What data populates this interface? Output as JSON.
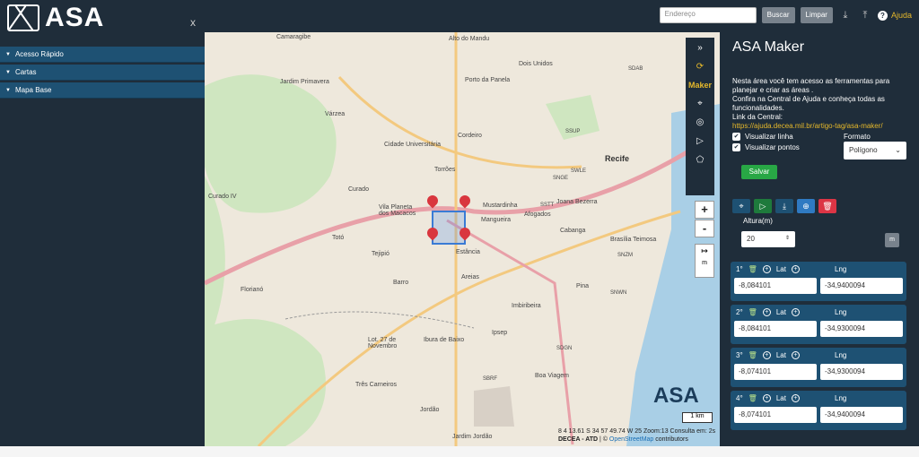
{
  "app": {
    "logo_text": "ASA",
    "close_label": "x"
  },
  "topbar": {
    "address_placeholder": "Endereço",
    "search_label": "Buscar",
    "clear_label": "Limpar",
    "help_label": "Ajuda"
  },
  "sidebar": {
    "items": [
      {
        "label": "Acesso Rápido"
      },
      {
        "label": "Cartas"
      },
      {
        "label": "Mapa Base"
      }
    ]
  },
  "map": {
    "labels": [
      "Camaragibe",
      "Alto do Mandu",
      "Dois Unidos",
      "Jardim Primavera",
      "Porto da Panela",
      "Várzea",
      "Cidade Universitária",
      "Cordeiro",
      "Torrões",
      "Recife",
      "Curado IV",
      "Mustardinha",
      "Curado",
      "Vila Planeta dos Macacos",
      "Mangueira",
      "Afogados",
      "Joana Bezerra",
      "Cabanga",
      "Totó",
      "Tejipió",
      "Estância",
      "Areias",
      "Brasília Teimosa",
      "Barro",
      "Pina",
      "Florianó",
      "Ibura de Baixo",
      "Ipsep",
      "Imbiribeira",
      "Boa Viagem",
      "Lot. 27 de Novembro",
      "Três Carneiros",
      "Jordão",
      "Jardim Jordão"
    ],
    "airports": [
      "SDAB",
      "SSUP",
      "SNGE",
      "SWLE",
      "SSTT",
      "SNZM",
      "SNWN",
      "SDGN",
      "SBRF"
    ],
    "zoom_in": "+",
    "zoom_out": "-",
    "measure_label": "m",
    "coord_readout": "8 4 13.61 S 34 57 49.74 W 25 Zoom:13 Consulta em: 2s",
    "attribution_owner": "DECEA - ATD",
    "attribution_link": "OpenStreetMap",
    "attribution_suffix": "contributors",
    "scale_label": "1 km",
    "brand": "ASA"
  },
  "tools": {
    "maker_label": "Maker"
  },
  "panel": {
    "title": "ASA Maker",
    "desc1": "Nesta área você tem acesso as ferramentas para planejar e criar as áreas .",
    "desc2": "Confira na Central de Ajuda e conheça todas as funcionalidades.",
    "desc3": "Link da Central:",
    "link": "https://ajuda.decea.mil.br/artigo-tag/asa-maker/",
    "show_line": "Visualizar linha",
    "show_points": "Visualizar pontos",
    "format_label": "Formato",
    "format_value": "Polígono",
    "save_label": "Salvar",
    "height_label": "Altura(m)",
    "height_value": "20",
    "height_unit": "m",
    "lat_label": "Lat",
    "lng_label": "Lng",
    "points": [
      {
        "index": "1°",
        "lat": "-8,084101",
        "lng": "-34,9400094"
      },
      {
        "index": "2°",
        "lat": "-8,084101",
        "lng": "-34,9300094"
      },
      {
        "index": "3°",
        "lat": "-8,074101",
        "lng": "-34,9300094"
      },
      {
        "index": "4°",
        "lat": "-8,074101",
        "lng": "-34,9400094"
      }
    ]
  },
  "colors": {
    "dark": "#1f2d3a",
    "accent": "#e5b82b",
    "row": "#1e5173",
    "green": "#28a745",
    "red": "#dc3545"
  }
}
